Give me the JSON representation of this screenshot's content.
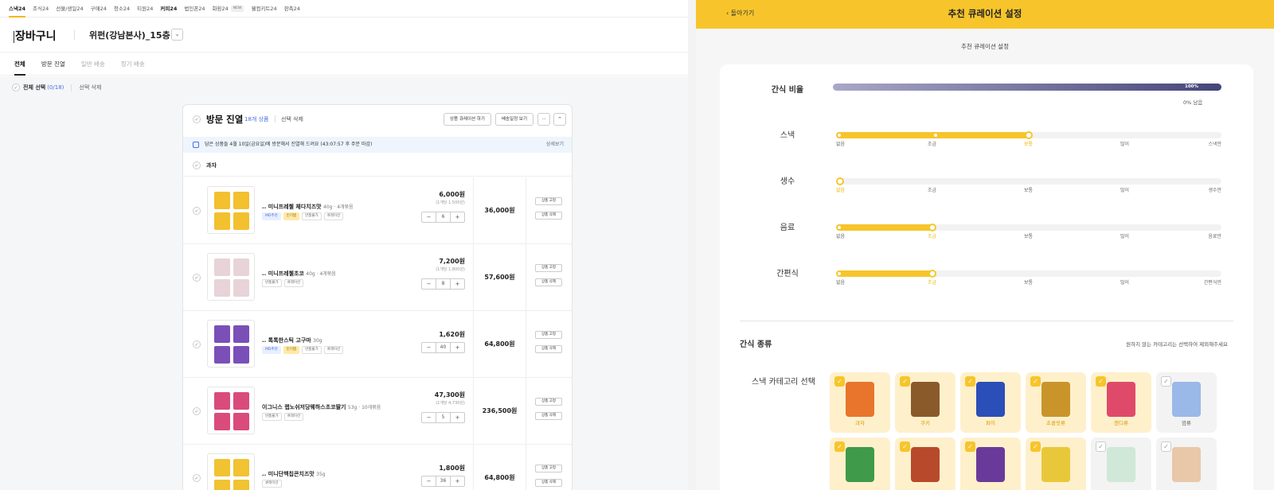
{
  "topnav": [
    "스낵24",
    "조식24",
    "선물/생일24",
    "구매24",
    "청소24",
    "티원24",
    "커피24",
    "법인폰24",
    "화환24",
    "웰컴키트24",
    "판촉24"
  ],
  "topnav_new": "NEW",
  "cart": {
    "title": "장바구니",
    "location": "위펀(강남본사)_15층",
    "dropdown_icon": "chevron-down"
  },
  "tabs": [
    "전체",
    "방문 진열",
    "일반 배송",
    "정기 배송"
  ],
  "select_all": {
    "label": "전체 선택",
    "count": "(0/18)",
    "delete": "선택 삭제"
  },
  "card": {
    "title": "방문 진열",
    "count": "18개 상품",
    "delete": "선택 삭제",
    "btn_curation": "상품 큐레이션 하기",
    "btn_schedule": "배송일정 보기",
    "btn_more": "···",
    "btn_collapse": "^",
    "notice": "담은 상품들 4월 10일(금요일)에 방문해서 진열해 드려요 (43:07:57 후 주문 마감)",
    "notice_more": "상세보기",
    "category": "과자"
  },
  "products": [
    {
      "name": ".. 미니프레첼 체다치즈맛",
      "meta": "40g · 4개묶음",
      "tags": [
        {
          "t": "MD추천",
          "c": "blue"
        },
        {
          "t": "인기템",
          "c": "yel"
        },
        {
          "t": "반품불가",
          "c": ""
        },
        {
          "t": "큐레이션",
          "c": ""
        }
      ],
      "price": "6,000원",
      "unit": "(1개당 1,500원)",
      "qty": "6",
      "total": "36,000원",
      "color": "#f3c02f"
    },
    {
      "name": ".. 미니프레첼초코",
      "meta": "40g · 4개묶음",
      "tags": [
        {
          "t": "반품불가",
          "c": ""
        },
        {
          "t": "큐레이션",
          "c": ""
        }
      ],
      "price": "7,200원",
      "unit": "(1개당 1,800원)",
      "qty": "8",
      "total": "57,600원",
      "color": "#e7d3d8"
    },
    {
      "name": ".. 톡톡한스틱 고구마",
      "meta": "30g",
      "tags": [
        {
          "t": "MD추천",
          "c": "blue"
        },
        {
          "t": "인기템",
          "c": "yel"
        },
        {
          "t": "반품불가",
          "c": ""
        },
        {
          "t": "큐레이션",
          "c": ""
        }
      ],
      "price": "1,620원",
      "unit": "",
      "qty": "40",
      "total": "64,800원",
      "color": "#7b4fb8"
    },
    {
      "name": "이그니스 랩노쉬저당웨하스초코딸기",
      "meta": "53g · 10개묶음",
      "tags": [
        {
          "t": "반품불가",
          "c": ""
        },
        {
          "t": "큐레이션",
          "c": ""
        }
      ],
      "price": "47,300원",
      "unit": "(1개당 4,730원)",
      "qty": "5",
      "total": "236,500원",
      "color": "#d94b7b"
    },
    {
      "name": ".. 미니단백칩콘치즈맛",
      "meta": "35g",
      "tags": [
        {
          "t": "큐레이션",
          "c": ""
        }
      ],
      "price": "1,800원",
      "unit": "",
      "qty": "36",
      "total": "64,800원",
      "color": "#f1c232"
    }
  ],
  "row_buttons": {
    "edit": "상품 고정",
    "delete": "상품 삭제"
  },
  "right": {
    "back": "돌아가기",
    "title": "추천 큐레이션 설정",
    "subtitle": "추천 큐레이션 설정",
    "ratio_label": "간식 비율",
    "ratio_pct": "100%",
    "ratio_sub": "0% 남음",
    "sliders": [
      {
        "label": "스낵",
        "value": 0.5,
        "ticks": [
          "없음",
          "조금",
          "보통",
          "많이",
          "스낵만"
        ],
        "sel": 2
      },
      {
        "label": "생수",
        "value": 0,
        "ticks": [
          "없음",
          "조금",
          "보통",
          "많이",
          "생수만"
        ],
        "sel": 0
      },
      {
        "label": "음료",
        "value": 0.25,
        "ticks": [
          "없음",
          "조금",
          "보통",
          "많이",
          "음료만"
        ],
        "sel": 1
      },
      {
        "label": "간편식",
        "value": 0.25,
        "ticks": [
          "없음",
          "조금",
          "보통",
          "많이",
          "간편식만"
        ],
        "sel": 1
      }
    ],
    "kinds_label": "간식 종류",
    "kinds_note": "원하지 않는 카테고리는 선택하여 제외해주세요",
    "snack_cat_label": "스낵 카테고리 선택",
    "tiles": [
      {
        "label": "과자",
        "on": true,
        "color": "#e8752b"
      },
      {
        "label": "쿠키",
        "on": true,
        "color": "#8a5a2b"
      },
      {
        "label": "파이",
        "on": true,
        "color": "#2b4fb8"
      },
      {
        "label": "초콜릿류",
        "on": true,
        "color": "#c9952b"
      },
      {
        "label": "캔디류",
        "on": true,
        "color": "#e04a6a"
      },
      {
        "label": "껌류",
        "on": false,
        "color": "#9ab8e8"
      },
      {
        "label": "",
        "on": true,
        "color": "#3f9a4a"
      },
      {
        "label": "",
        "on": true,
        "color": "#b84a2b"
      },
      {
        "label": "",
        "on": true,
        "color": "#6a3a9a"
      },
      {
        "label": "",
        "on": true,
        "color": "#e8c83a"
      },
      {
        "label": "",
        "on": false,
        "color": "#cfe8d8"
      },
      {
        "label": "",
        "on": false,
        "color": "#e8c8a8"
      }
    ],
    "check_icon": "✓"
  }
}
